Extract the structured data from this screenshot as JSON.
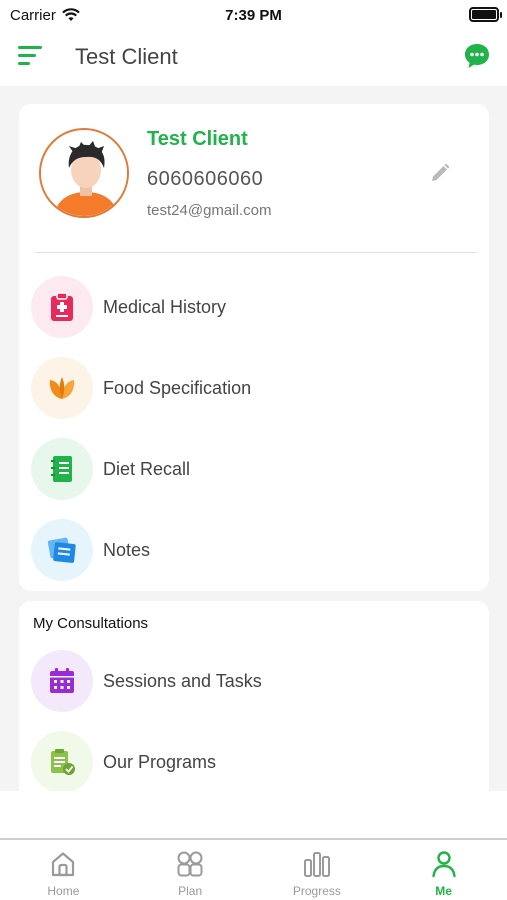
{
  "status_bar": {
    "carrier": "Carrier",
    "time": "7:39 PM"
  },
  "header": {
    "title": "Test Client",
    "menu_icon": "hamburger-icon",
    "chat_icon": "chat-bubble-icon"
  },
  "profile": {
    "name": "Test Client",
    "phone": "6060606060",
    "email": "test24@gmail.com",
    "edit_icon": "pencil-icon"
  },
  "menu": [
    {
      "label": "Medical History",
      "icon": "clipboard-icon",
      "color": "#e8295b",
      "bg": "#fdeaf0"
    },
    {
      "label": "Food Specification",
      "icon": "leaf-icon",
      "color": "#f08c1a",
      "bg": "#fdf3e6"
    },
    {
      "label": "Diet Recall",
      "icon": "notebook-icon",
      "color": "#20b34a",
      "bg": "#e7f7ec"
    },
    {
      "label": "Notes",
      "icon": "sticky-notes-icon",
      "color": "#1e88e5",
      "bg": "#e6f4fb"
    }
  ],
  "consultations": {
    "title": "My Consultations",
    "items": [
      {
        "label": "Sessions and Tasks",
        "icon": "calendar-icon",
        "color": "#9b2bd8",
        "bg": "#f4e8fb"
      },
      {
        "label": "Our Programs",
        "icon": "program-icon",
        "color": "#8bc34a",
        "bg": "#f1f9e8"
      }
    ]
  },
  "nav": [
    {
      "label": "Home",
      "icon": "home-icon",
      "active": false
    },
    {
      "label": "Plan",
      "icon": "plan-grid-icon",
      "active": false
    },
    {
      "label": "Progress",
      "icon": "bar-chart-icon",
      "active": false
    },
    {
      "label": "Me",
      "icon": "person-icon",
      "active": true
    }
  ],
  "colors": {
    "accent": "#20b34a",
    "inactive": "#9a9a9a"
  }
}
